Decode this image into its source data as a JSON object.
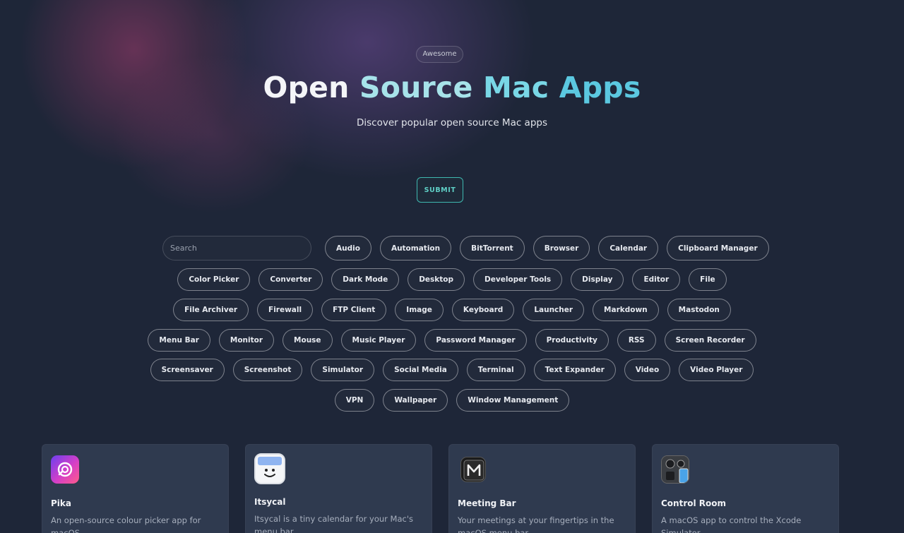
{
  "hero": {
    "badge": "Awesome",
    "title_words": [
      "Open",
      "Source",
      "Mac",
      "Apps"
    ],
    "subtitle": "Discover popular open source Mac apps",
    "submit_label": "SUBMIT"
  },
  "search": {
    "placeholder": "Search",
    "value": ""
  },
  "categories": {
    "row1": [
      "Audio",
      "Automation",
      "BitTorrent",
      "Browser",
      "Calendar",
      "Clipboard Manager"
    ],
    "row2": [
      "Color Picker",
      "Converter",
      "Dark Mode",
      "Desktop",
      "Developer Tools",
      "Display",
      "Editor",
      "File"
    ],
    "row3": [
      "File Archiver",
      "Firewall",
      "FTP Client",
      "Image",
      "Keyboard",
      "Launcher",
      "Markdown",
      "Mastodon"
    ],
    "row4": [
      "Menu Bar",
      "Monitor",
      "Mouse",
      "Music Player",
      "Password Manager",
      "Productivity",
      "RSS",
      "Screen Recorder"
    ],
    "row5": [
      "Screensaver",
      "Screenshot",
      "Simulator",
      "Social Media",
      "Terminal",
      "Text Expander",
      "Video",
      "Video Player"
    ],
    "row6": [
      "VPN",
      "Wallpaper",
      "Window Management"
    ]
  },
  "apps": [
    {
      "name": "Pika",
      "description": "An open-source colour picker app for macOS",
      "icon": "pika-icon"
    },
    {
      "name": "Itsycal",
      "description": "Itsycal is a tiny calendar for your Mac's menu bar",
      "icon": "itsycal-icon"
    },
    {
      "name": "Meeting Bar",
      "description": "Your meetings at your fingertips in the macOS menu bar",
      "icon": "meeting-bar-icon"
    },
    {
      "name": "Control Room",
      "description": "A macOS app to control the Xcode Simulator.",
      "icon": "control-room-icon"
    }
  ],
  "colors": {
    "background": "#1e2638",
    "accent": "#5bc8e0",
    "submit_border": "#3fb8b0",
    "card_background": "#2f3a4f"
  }
}
